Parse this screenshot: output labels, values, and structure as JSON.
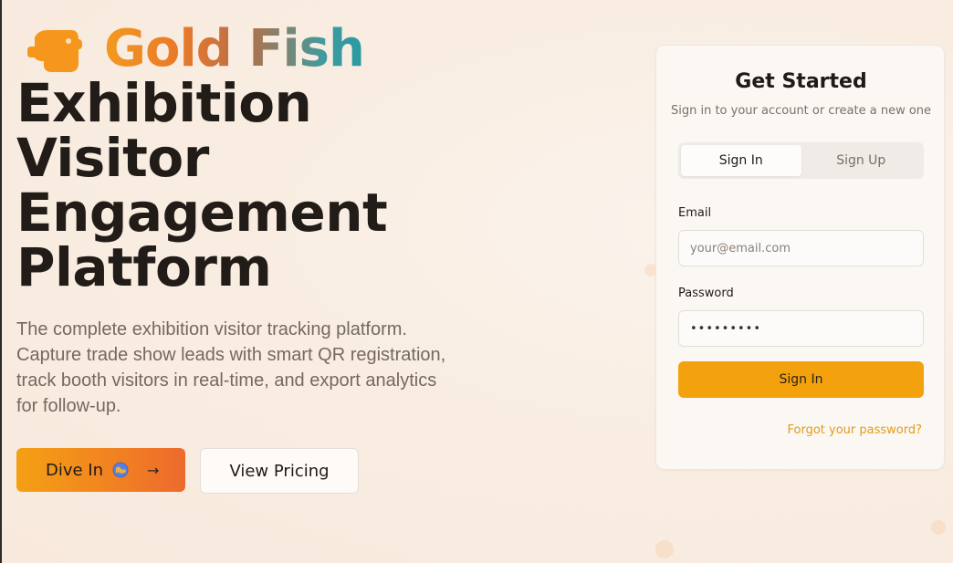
{
  "brand": {
    "name": "Gold Fish",
    "logo_icon": "goldfish-icon"
  },
  "hero": {
    "title_lines": [
      "Exhibition",
      "Visitor",
      "Engagement",
      "Platform"
    ],
    "description": "The complete exhibition visitor tracking platform. Capture trade show leads with smart QR registration, track booth visitors in real-time, and export analytics for follow-up.",
    "primary_cta": "Dive In",
    "primary_cta_icons": [
      "globe-icon",
      "arrow-right-icon"
    ],
    "secondary_cta": "View Pricing"
  },
  "auth_card": {
    "title": "Get Started",
    "subtitle": "Sign in to your account or create a new one",
    "tabs": [
      {
        "label": "Sign In",
        "active": true
      },
      {
        "label": "Sign Up",
        "active": false
      }
    ],
    "email_label": "Email",
    "email_placeholder": "your@email.com",
    "password_label": "Password",
    "password_value": "•••••••••",
    "submit_label": "Sign In",
    "forgot_label": "Forgot your password?"
  },
  "colors": {
    "accent": "#f4a10e",
    "primary_gradient_start": "#f5a014",
    "primary_gradient_end": "#ec6a2e",
    "link": "#e29a1a",
    "heading": "#221c18",
    "background": "#f9ede2"
  }
}
